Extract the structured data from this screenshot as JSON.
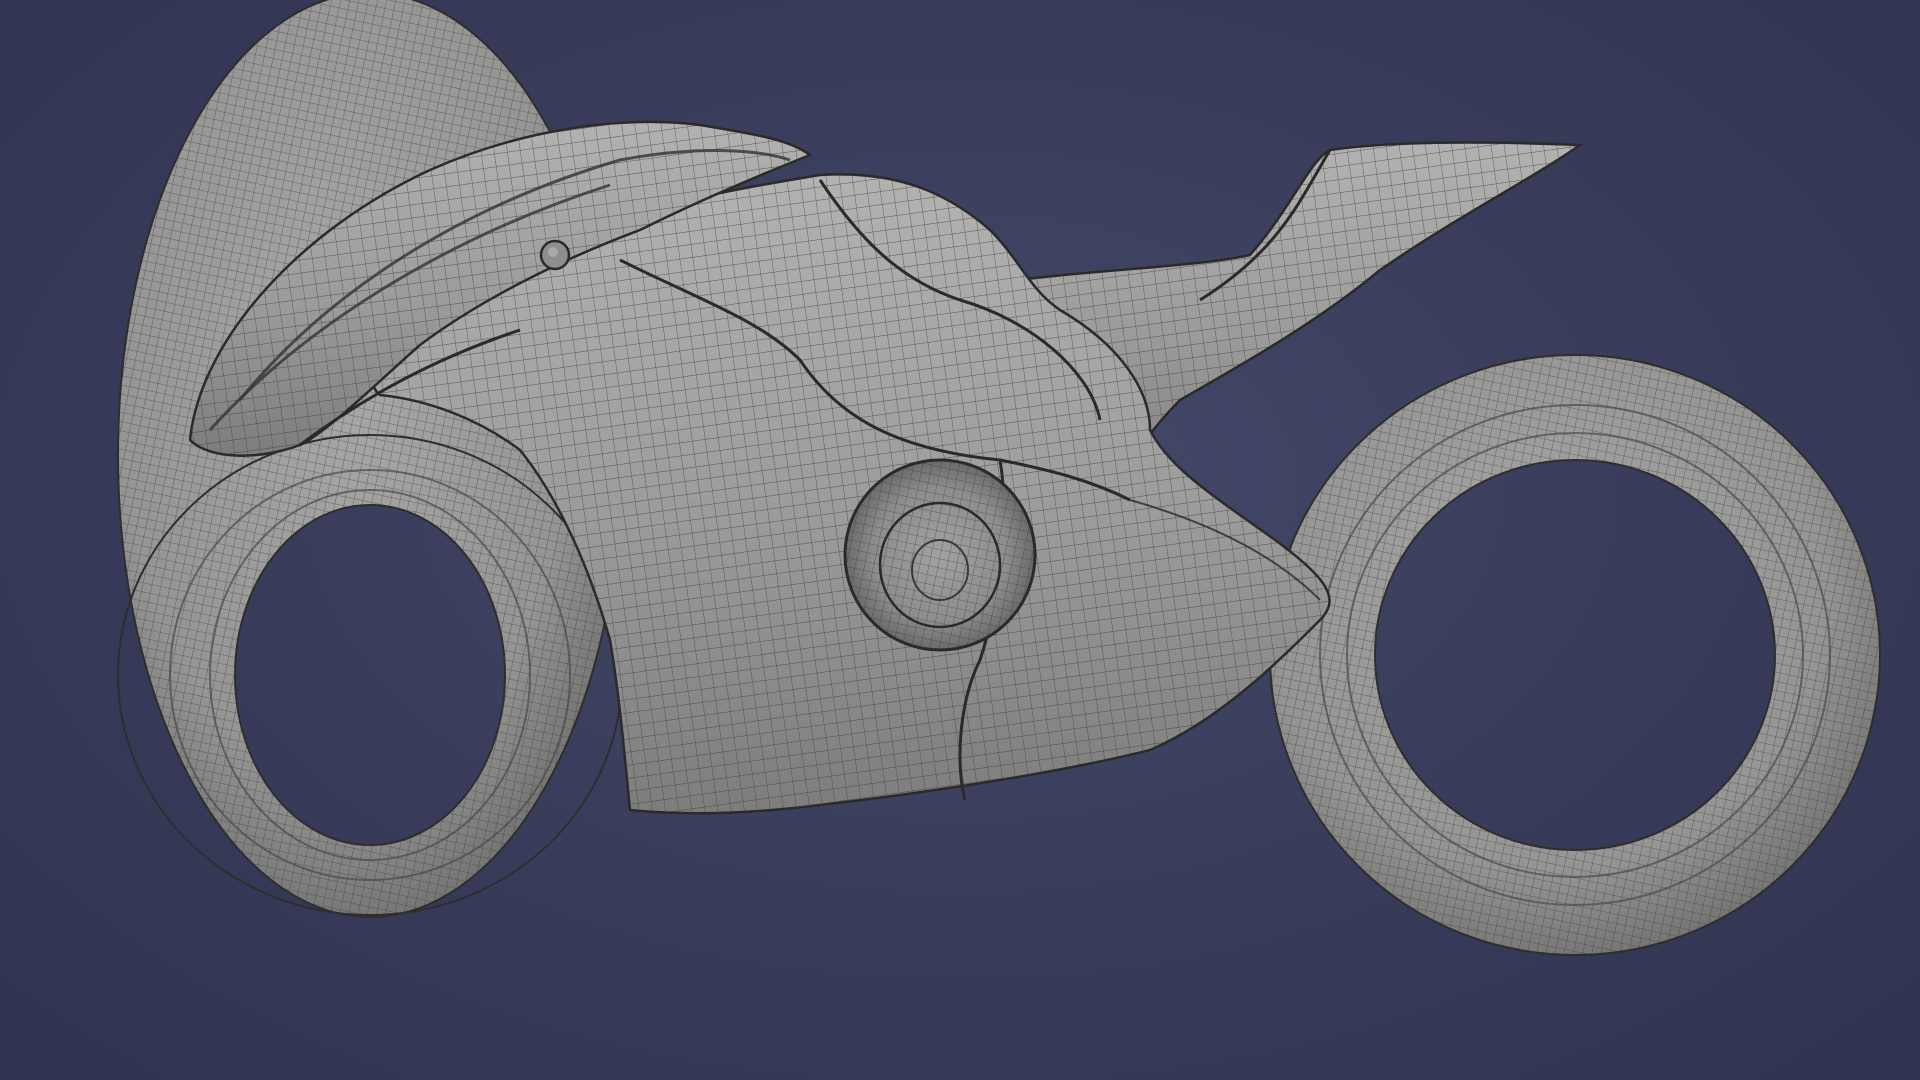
{
  "viewport": {
    "background_color": "#3a3e5c",
    "model": {
      "subject": "motorcycle",
      "display_mode": "wireframe-on-shaded",
      "surface_color": "#9a9a98",
      "wire_color": "#3a3a3a"
    }
  }
}
